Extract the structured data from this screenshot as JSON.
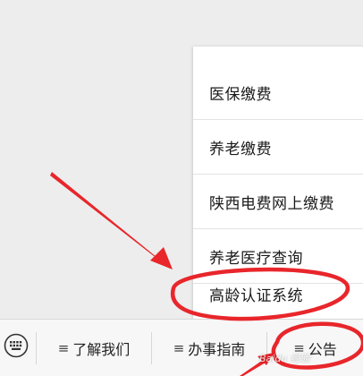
{
  "popup_menu": {
    "items": [
      {
        "label": "医保缴费"
      },
      {
        "label": "养老缴费"
      },
      {
        "label": "陕西电费网上缴费"
      },
      {
        "label": "养老医疗查询"
      },
      {
        "label": "高龄认证系统"
      }
    ]
  },
  "bottom_menu": {
    "tabs": [
      {
        "icon": "≡",
        "label": "了解我们"
      },
      {
        "icon": "≡",
        "label": "办事指南"
      },
      {
        "icon": "≡",
        "label": "公告"
      }
    ]
  },
  "watermark": {
    "text": "Baidu 经验"
  },
  "colors": {
    "annotation_red": "#e8262b"
  }
}
